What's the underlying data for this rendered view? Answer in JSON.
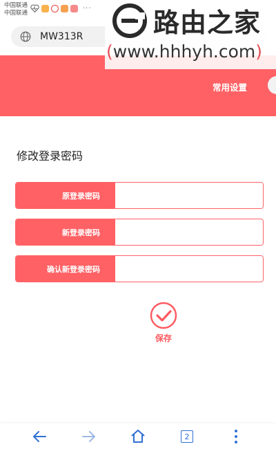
{
  "status_bar": {
    "carrier_1": "中国联通",
    "carrier_2": "中国联通",
    "more": "···"
  },
  "address_bar": {
    "url": "MW313R"
  },
  "watermark": {
    "title": "路由之家",
    "url_open": "(",
    "url": "www.hhhyh.com",
    "url_close": ")"
  },
  "header": {
    "link_label": "常用设置"
  },
  "form": {
    "title": "修改登录密码",
    "fields": [
      {
        "label": "原登录密码",
        "value": ""
      },
      {
        "label": "新登录密码",
        "value": ""
      },
      {
        "label": "确认新登录密码",
        "value": ""
      }
    ]
  },
  "save": {
    "label": "保存"
  },
  "bottom_nav": {
    "tab_count": "2"
  },
  "colors": {
    "accent": "#ff6165",
    "nav_icon": "#2f6fd4"
  },
  "icons": [
    "heart-icon",
    "globe-icon",
    "check-icon",
    "back-arrow-icon",
    "forward-arrow-icon",
    "home-icon",
    "tabs-icon",
    "menu-icon"
  ]
}
